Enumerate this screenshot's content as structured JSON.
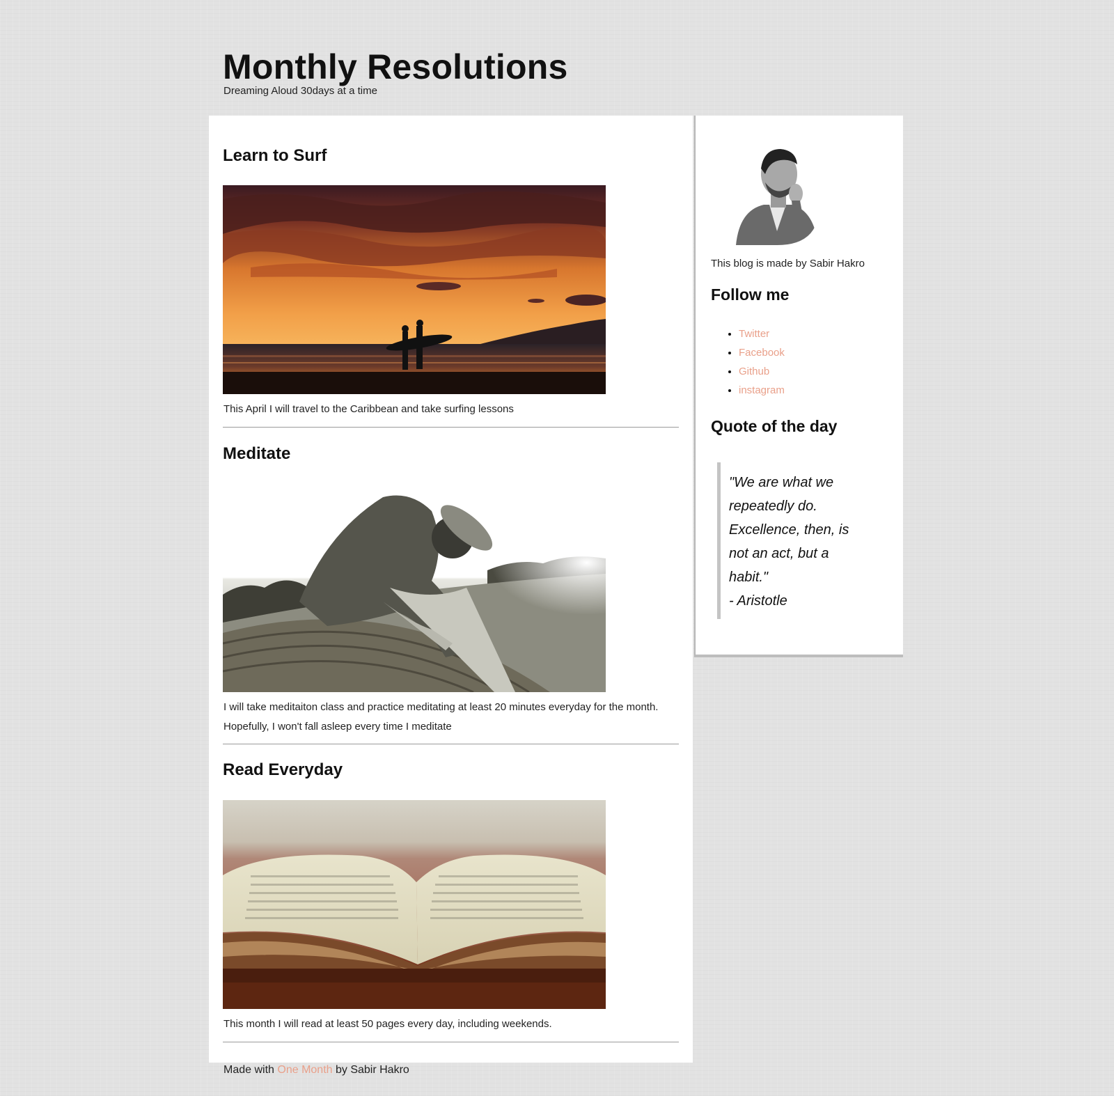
{
  "header": {
    "title": "Monthly Resolutions",
    "tagline": "Dreaming Aloud 30days at a time"
  },
  "posts": [
    {
      "title": "Learn to Surf",
      "text": "This April I will travel to the Caribbean and take surfing lessons"
    },
    {
      "title": "Meditate",
      "text": "I will take meditaiton class and practice meditating at least 20 minutes everyday for the month. Hopefully, I won't fall asleep every time I meditate"
    },
    {
      "title": "Read Everyday",
      "text": "This month I will read at least 50 pages every day, including weekends."
    }
  ],
  "sidebar": {
    "bio": "This blog is made by Sabir Hakro",
    "follow_heading": "Follow me",
    "links": [
      "Twitter",
      "Facebook",
      "Github",
      "instagram"
    ],
    "quote_heading": "Quote of the day",
    "quote_text": "\"We are what we repeatedly do. Excellence, then, is not an act, but a habit.\"",
    "quote_author": "- Aristotle"
  },
  "footer": {
    "prefix": "Made with ",
    "link": "One Month",
    "suffix": " by Sabir Hakro"
  },
  "colors": {
    "link": "#e9a08a",
    "page_background": "#e2e2e2",
    "card_background": "#ffffff"
  }
}
